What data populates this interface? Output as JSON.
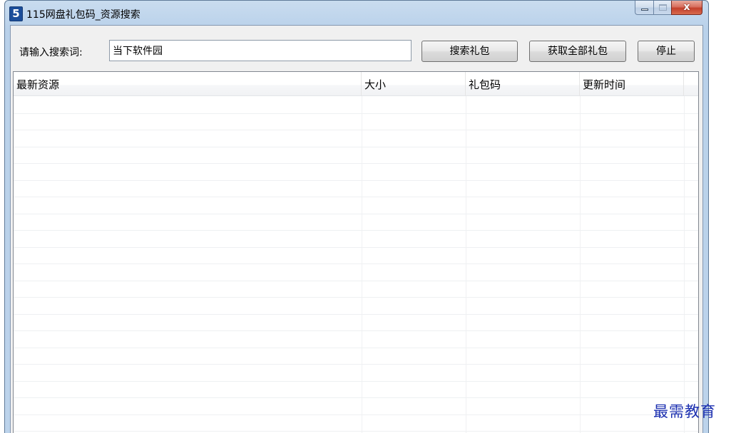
{
  "window": {
    "title": "115网盘礼包码_资源搜索",
    "icon_letter": "5",
    "icon": "app-s-icon",
    "caption_close_glyph": "x"
  },
  "search": {
    "label": "请输入搜索词:",
    "value": "当下软件园",
    "placeholder": ""
  },
  "toolbar": {
    "search_label": "搜索礼包",
    "get_all_label": "获取全部礼包",
    "stop_label": "停止"
  },
  "table": {
    "columns": [
      "最新资源",
      "大小",
      "礼包码",
      "更新时间"
    ],
    "rows": []
  },
  "watermark": "最需教育",
  "colors": {
    "frame": "#b9d1ea",
    "close_button": "#c3402c",
    "watermark": "#1b2fb0"
  }
}
